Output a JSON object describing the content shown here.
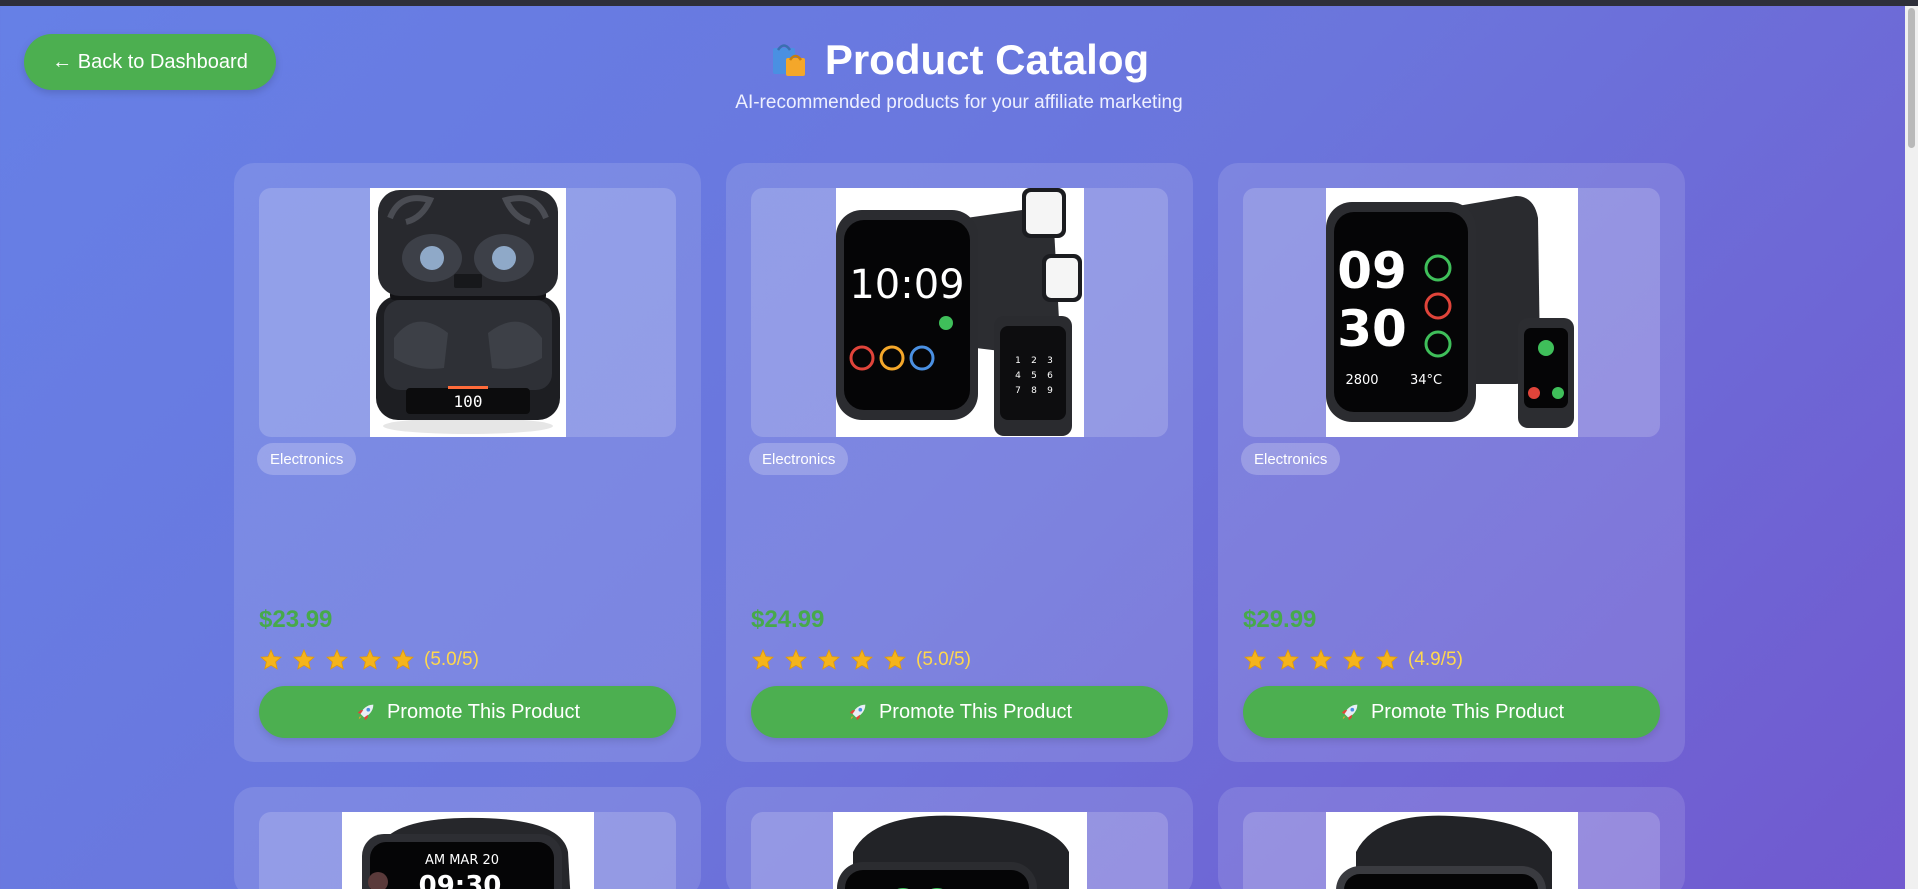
{
  "nav": {
    "back_label": "← Back to Dashboard"
  },
  "header": {
    "icon": "shopping-bags-icon",
    "title": "Product Catalog",
    "subtitle": "AI-recommended products for your affiliate marketing"
  },
  "colors": {
    "accent": "#4caf50",
    "price": "#47a94b",
    "rating": "#ffd84d"
  },
  "products": [
    {
      "category": "Electronics",
      "price": "$23.99",
      "rating": 5.0,
      "rating_text": "(5.0/5)",
      "promote_label": "Promote This Product",
      "image": "wireless-earbuds"
    },
    {
      "category": "Electronics",
      "price": "$24.99",
      "rating": 5.0,
      "rating_text": "(5.0/5)",
      "promote_label": "Promote This Product",
      "image": "smart-watch"
    },
    {
      "category": "Electronics",
      "price": "$29.99",
      "rating": 4.9,
      "rating_text": "(4.9/5)",
      "promote_label": "Promote This Product",
      "image": "smart-watch"
    },
    {
      "image": "smart-watch"
    },
    {
      "image": "smart-watch"
    },
    {
      "image": "smart-watch"
    }
  ]
}
